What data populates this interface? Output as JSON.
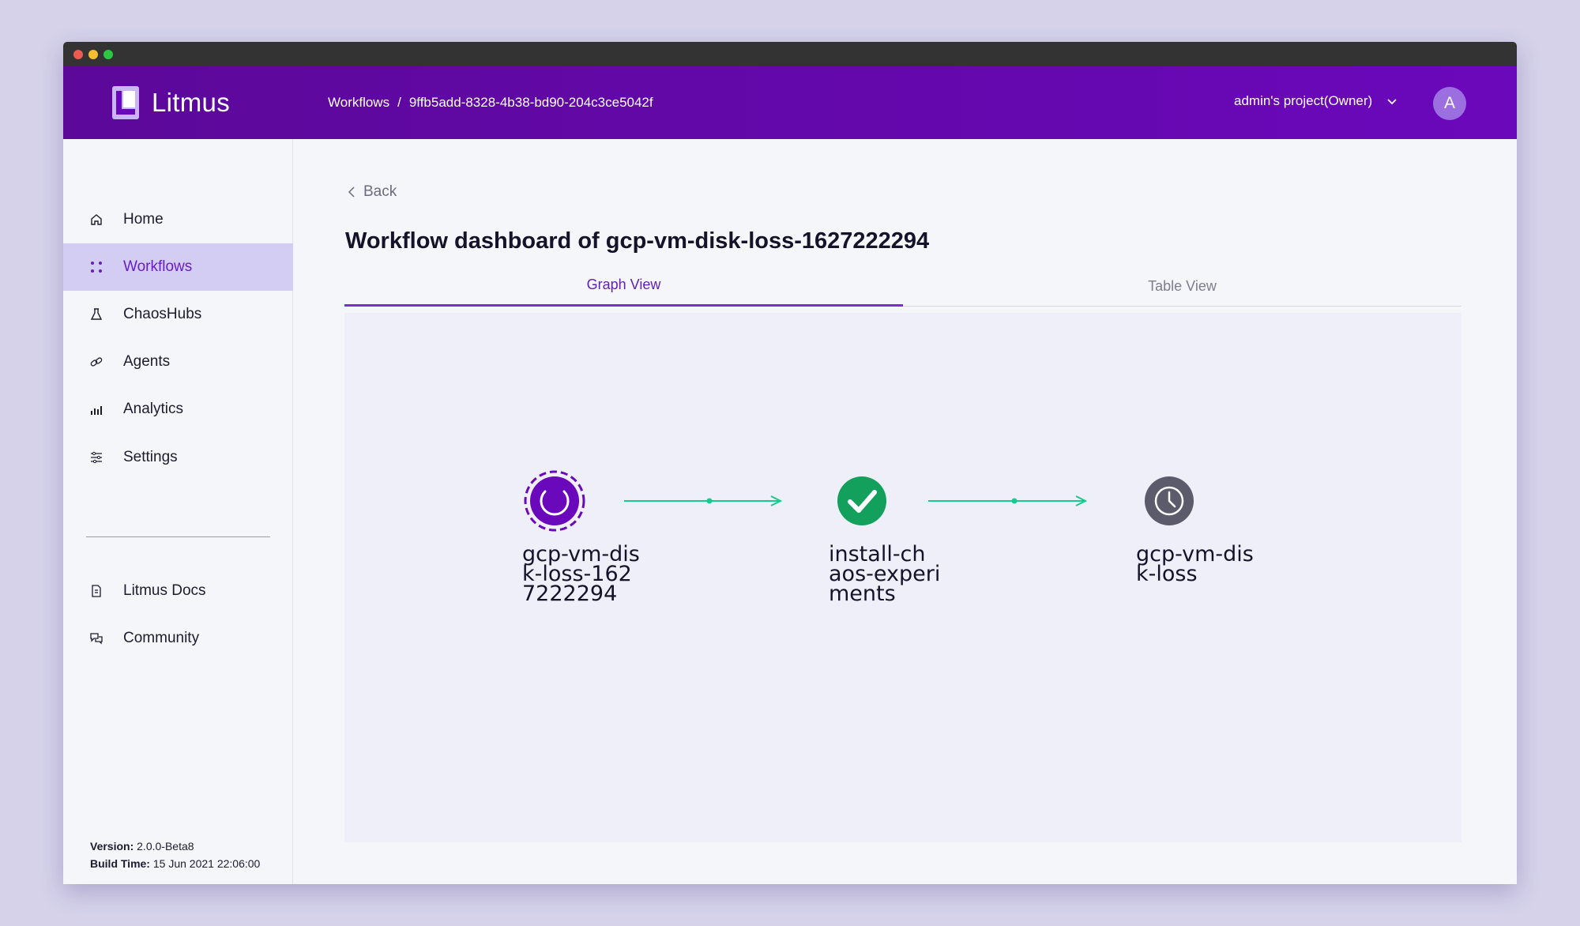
{
  "app": {
    "name": "Litmus",
    "avatar_initial": "A",
    "project": "admin's project(Owner)"
  },
  "breadcrumb": {
    "section": "Workflows",
    "separator": "/",
    "id": "9ffb5add-8328-4b38-bd90-204c3ce5042f"
  },
  "sidebar": {
    "items": [
      {
        "label": "Home",
        "icon": "home-icon"
      },
      {
        "label": "Workflows",
        "icon": "workflows-icon",
        "active": true
      },
      {
        "label": "ChaosHubs",
        "icon": "flask-icon"
      },
      {
        "label": "Agents",
        "icon": "link-icon"
      },
      {
        "label": "Analytics",
        "icon": "chart-icon"
      },
      {
        "label": "Settings",
        "icon": "sliders-icon"
      }
    ],
    "secondary": [
      {
        "label": "Litmus Docs",
        "icon": "document-icon"
      },
      {
        "label": "Community",
        "icon": "chat-icon"
      }
    ],
    "version_label": "Version:",
    "version": "2.0.0-Beta8",
    "build_label": "Build Time:",
    "build_time": "15 Jun 2021 22:06:00"
  },
  "main": {
    "back_label": "Back",
    "title": "Workflow dashboard of gcp-vm-disk-loss-1627222294",
    "tabs": [
      {
        "label": "Graph View",
        "active": true
      },
      {
        "label": "Table View",
        "active": false
      }
    ]
  },
  "graph": {
    "nodes": [
      {
        "label": "gcp-vm-dis\nk-loss-162\n7222294",
        "status": "running",
        "icon": "spinner-icon",
        "color": "#6a08bb"
      },
      {
        "label": "install-ch\naos-experi\nments",
        "status": "succeeded",
        "icon": "check-icon",
        "color": "#12a05c"
      },
      {
        "label": "gcp-vm-dis\nk-loss",
        "status": "pending",
        "icon": "clock-icon",
        "color": "#5b5b6c"
      }
    ],
    "edge_color": "#19c98e"
  }
}
